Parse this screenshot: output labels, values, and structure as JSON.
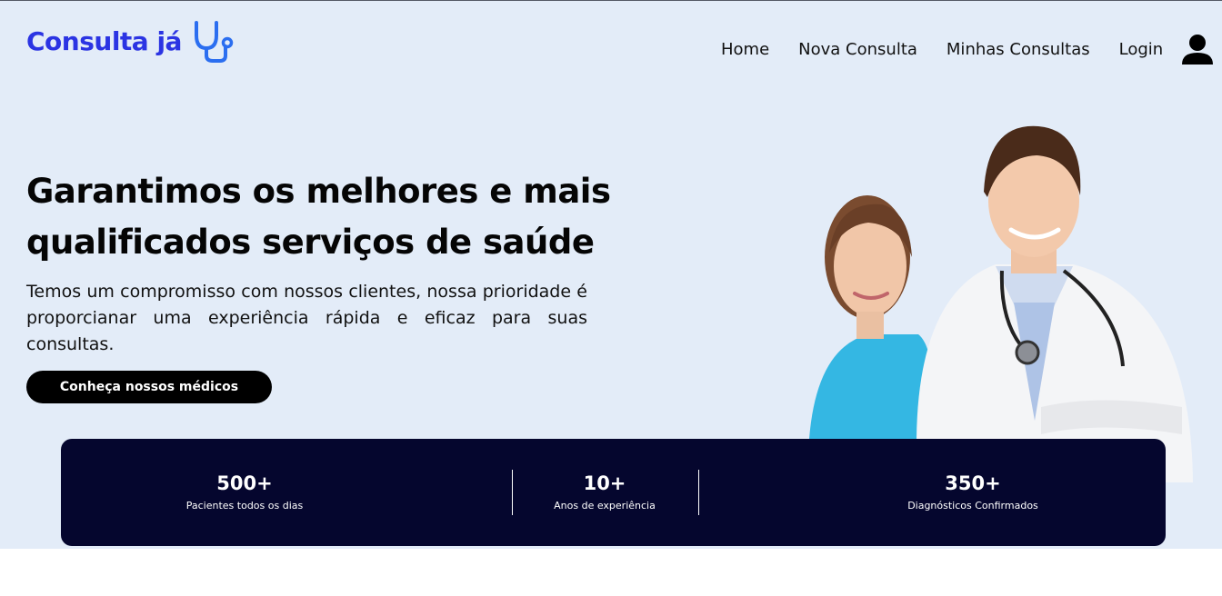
{
  "brand": {
    "name": "Consulta já",
    "icon": "stethoscope-icon",
    "color": "#2b34e3"
  },
  "nav": {
    "items": [
      "Home",
      "Nova Consulta",
      "Minhas Consultas",
      "Login"
    ],
    "user_icon": "user-icon"
  },
  "hero": {
    "headline_line1": "Garantimos os melhores e mais",
    "headline_line2": "qualificados serviços de saúde",
    "lead": "Temos um compromisso com nossos clientes, nossa prioridade é proporcianar uma experiência rápida e eficaz para suas consultas.",
    "cta_label": "Conheça nossos médicos",
    "background_color": "#e3ecf8"
  },
  "stats": {
    "background_color": "#05062e",
    "items": [
      {
        "value": "500+",
        "label": "Pacientes todos os dias"
      },
      {
        "value": "10+",
        "label": "Anos de experiência"
      },
      {
        "value": "350+",
        "label": "Diagnósticos Confirmados"
      }
    ]
  }
}
